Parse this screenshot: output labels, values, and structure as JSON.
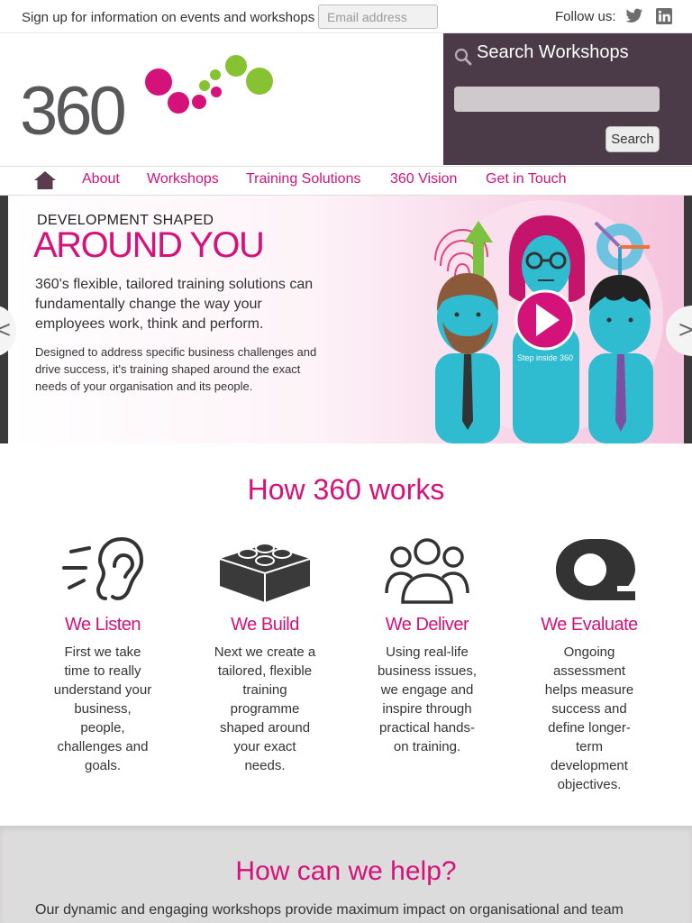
{
  "topbar": {
    "signup_text": "Sign up for information on events and workshops",
    "email_placeholder": "Email address",
    "follow_label": "Follow us:",
    "social": [
      "twitter-icon",
      "linkedin-icon"
    ]
  },
  "header": {
    "logo_text": "360",
    "search_title": "Search Workshops",
    "search_button": "Search"
  },
  "nav": {
    "home_icon": "home-icon",
    "items": [
      {
        "label": "About"
      },
      {
        "label": "Workshops"
      },
      {
        "label": "Training Solutions"
      },
      {
        "label": "360 Vision"
      },
      {
        "label": "Get in Touch"
      }
    ]
  },
  "hero": {
    "eyebrow": "DEVELOPMENT SHAPED",
    "headline": "AROUND YOU",
    "lead": "360's flexible, tailored training solutions can fundamentally change the way your employees work, think and perform.",
    "sub": "Designed to address specific business challenges and drive success, it's training shaped around the exact needs of your organisation and its people.",
    "video_caption": "Step inside 360",
    "prev_label": "<",
    "next_label": ">"
  },
  "works": {
    "title": "How 360 works",
    "steps": [
      {
        "title": "We Listen",
        "text": "First we take time to really understand your business, people, challenges and goals.",
        "icon": "ear-icon"
      },
      {
        "title": "We Build",
        "text": "Next we create a tailored, flexible training programme shaped around your exact needs.",
        "icon": "building-block-icon"
      },
      {
        "title": "We Deliver",
        "text": "Using real-life business issues, we engage and inspire through practical hands-on training.",
        "icon": "people-group-icon"
      },
      {
        "title": "We Evaluate",
        "text": "Ongoing assessment helps measure success and define longer-term development objectives.",
        "icon": "tape-measure-icon"
      }
    ]
  },
  "help": {
    "title": "How can we help?",
    "text": "Our dynamic and engaging workshops provide maximum impact on organisational and team"
  },
  "colors": {
    "brand_pink": "#d4127a",
    "brand_green": "#86c232",
    "search_panel": "#4b3a48",
    "logo_gray": "#58585a"
  }
}
